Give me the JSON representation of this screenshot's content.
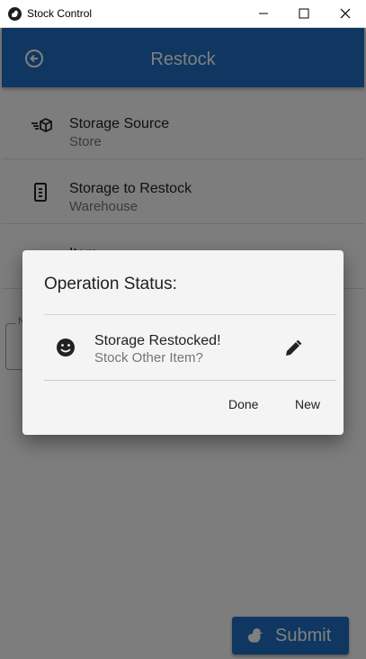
{
  "window": {
    "title": "Stock Control",
    "icons": {
      "app": "duck-logo-icon",
      "minimize": "minimize-icon",
      "maximize": "maximize-icon",
      "close": "close-icon"
    }
  },
  "toolbar": {
    "title": "Restock",
    "back_icon": "arrow-back-circle-icon",
    "color": "#1f6fc4"
  },
  "form": {
    "items": [
      {
        "icon": "packages-icon",
        "label": "Storage Source",
        "value": "Store"
      },
      {
        "icon": "storage-cabinet-icon",
        "label": "Storage to Restock",
        "value": "Warehouse"
      },
      {
        "icon": "item-icon",
        "label": "Item",
        "value": ""
      }
    ],
    "quantity_label": "N"
  },
  "submit": {
    "label": "Submit",
    "icon": "duck-icon"
  },
  "dialog": {
    "title": "Operation Status:",
    "message_primary": "Storage Restocked!",
    "message_secondary": "Stock Other Item?",
    "status_icon": "smiley-icon",
    "edit_icon": "pencil-icon",
    "buttons": {
      "done": "Done",
      "new": "New"
    }
  }
}
